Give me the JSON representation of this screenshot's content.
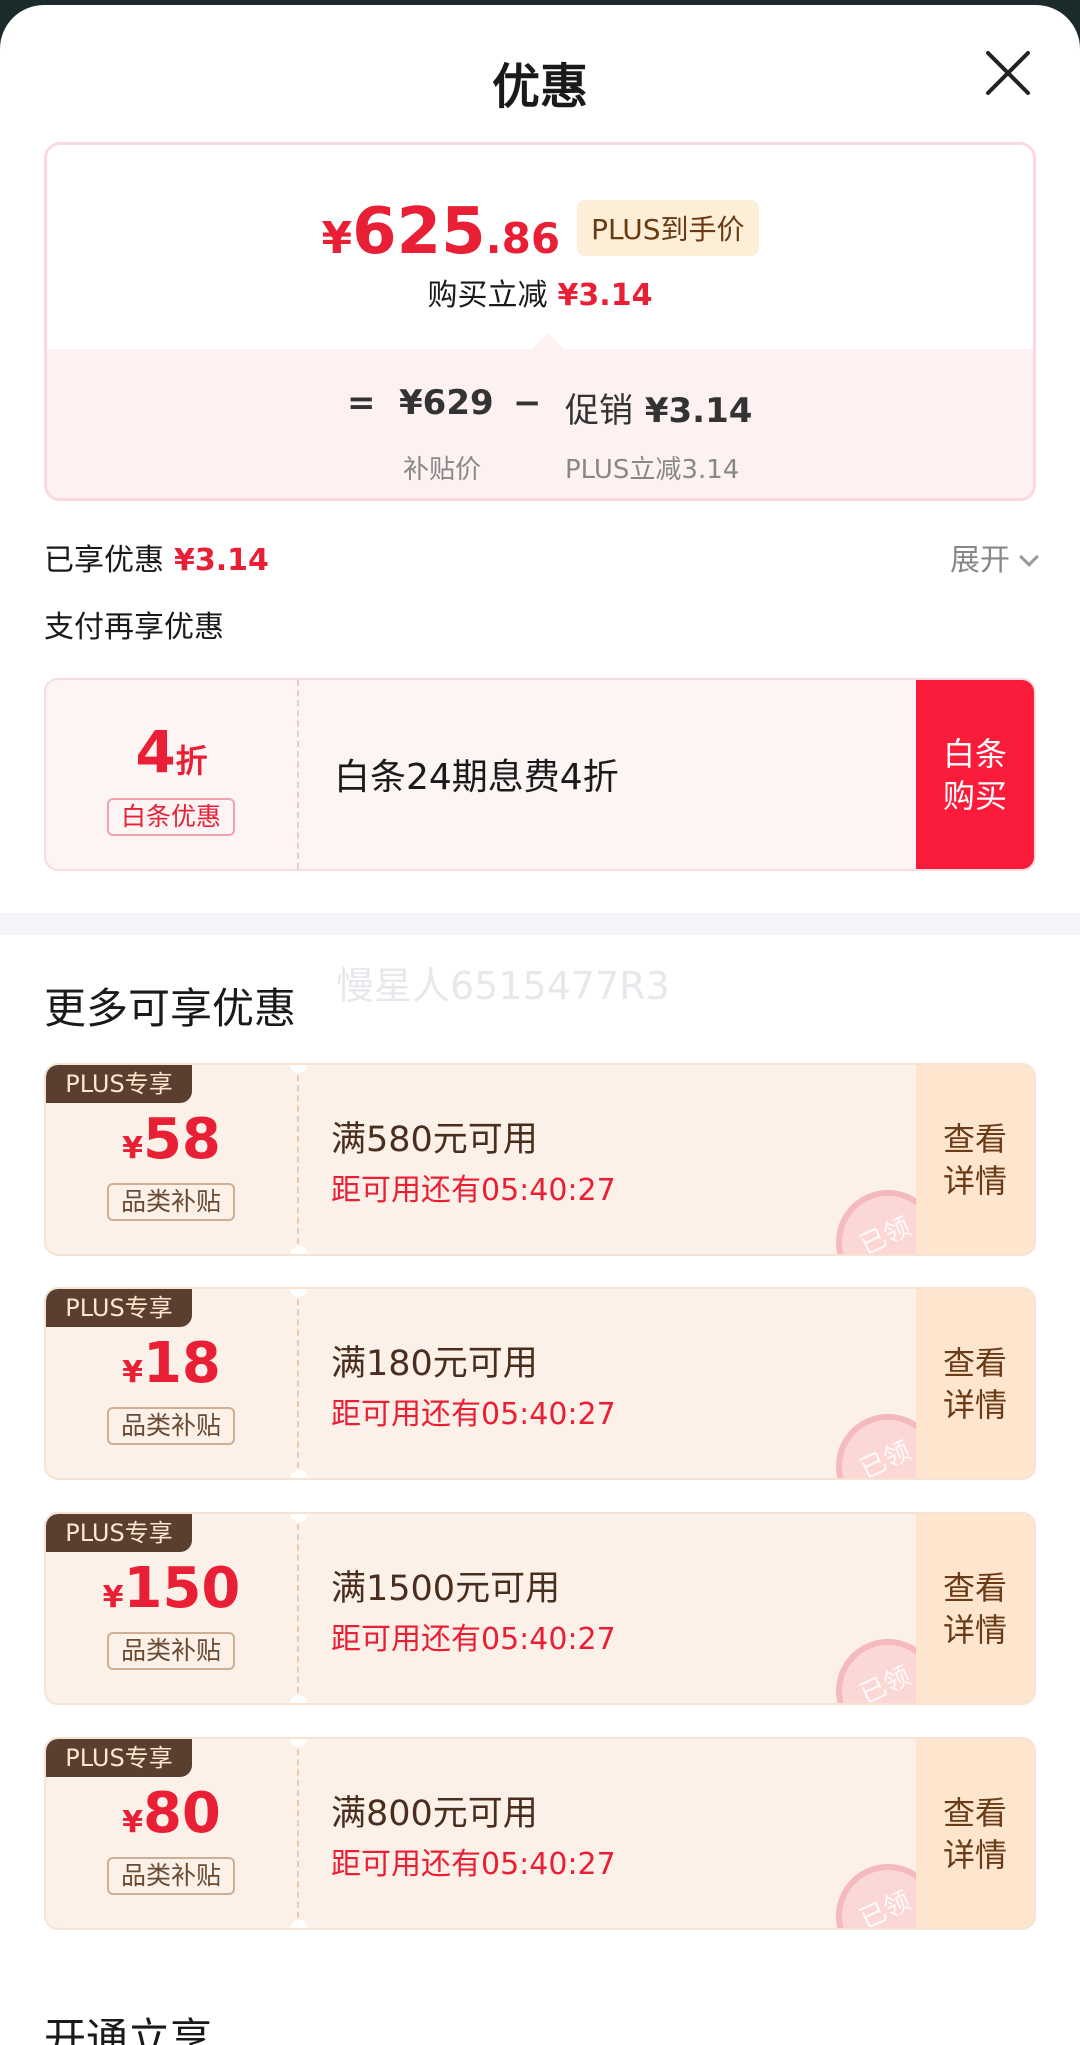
{
  "header": {
    "title": "优惠"
  },
  "price_card": {
    "final_price_yen": "¥",
    "final_price_int": "625",
    "final_price_dec": ".86",
    "plus_tag": "PLUS到手价",
    "reduce_label": "购买立减",
    "reduce_amount": "¥3.14",
    "formula": {
      "equals": "=",
      "base_price": "¥629",
      "base_label": "补贴价",
      "minus": "−",
      "promo_label": "促销",
      "promo_amount": "¥3.14",
      "promo_sub": "PLUS立减3.14"
    }
  },
  "enjoyed": {
    "label": "已享优惠",
    "amount": "¥3.14",
    "expand_label": "展开"
  },
  "pay_more": {
    "label": "支付再享优惠"
  },
  "baitiao": {
    "rate_num": "4",
    "rate_unit": "折",
    "type_label": "白条优惠",
    "description": "白条24期息费4折",
    "button_label": "白条购买"
  },
  "watermark": "慢星人6515477R3",
  "more_section": {
    "title": "更多可享优惠"
  },
  "coupons": [
    {
      "tag": "PLUS专享",
      "yen": "¥",
      "amount": "58",
      "category": "品类补贴",
      "condition": "满580元可用",
      "countdown": "距可用还有05:40:27",
      "button": "查看详情",
      "stamp": "已领"
    },
    {
      "tag": "PLUS专享",
      "yen": "¥",
      "amount": "18",
      "category": "品类补贴",
      "condition": "满180元可用",
      "countdown": "距可用还有05:40:27",
      "button": "查看详情",
      "stamp": "已领"
    },
    {
      "tag": "PLUS专享",
      "yen": "¥",
      "amount": "150",
      "category": "品类补贴",
      "condition": "满1500元可用",
      "countdown": "距可用还有05:40:27",
      "button": "查看详情",
      "stamp": "已领"
    },
    {
      "tag": "PLUS专享",
      "yen": "¥",
      "amount": "80",
      "category": "品类补贴",
      "condition": "满800元可用",
      "countdown": "距可用还有05:40:27",
      "button": "查看详情",
      "stamp": "已领"
    }
  ],
  "open_section": {
    "title": "开通立享"
  },
  "colors": {
    "accent_red": "#e91f36",
    "button_red": "#fa1c3a",
    "plus_brown": "#5a3e2f",
    "coupon_bg": "#fcf1e8"
  }
}
